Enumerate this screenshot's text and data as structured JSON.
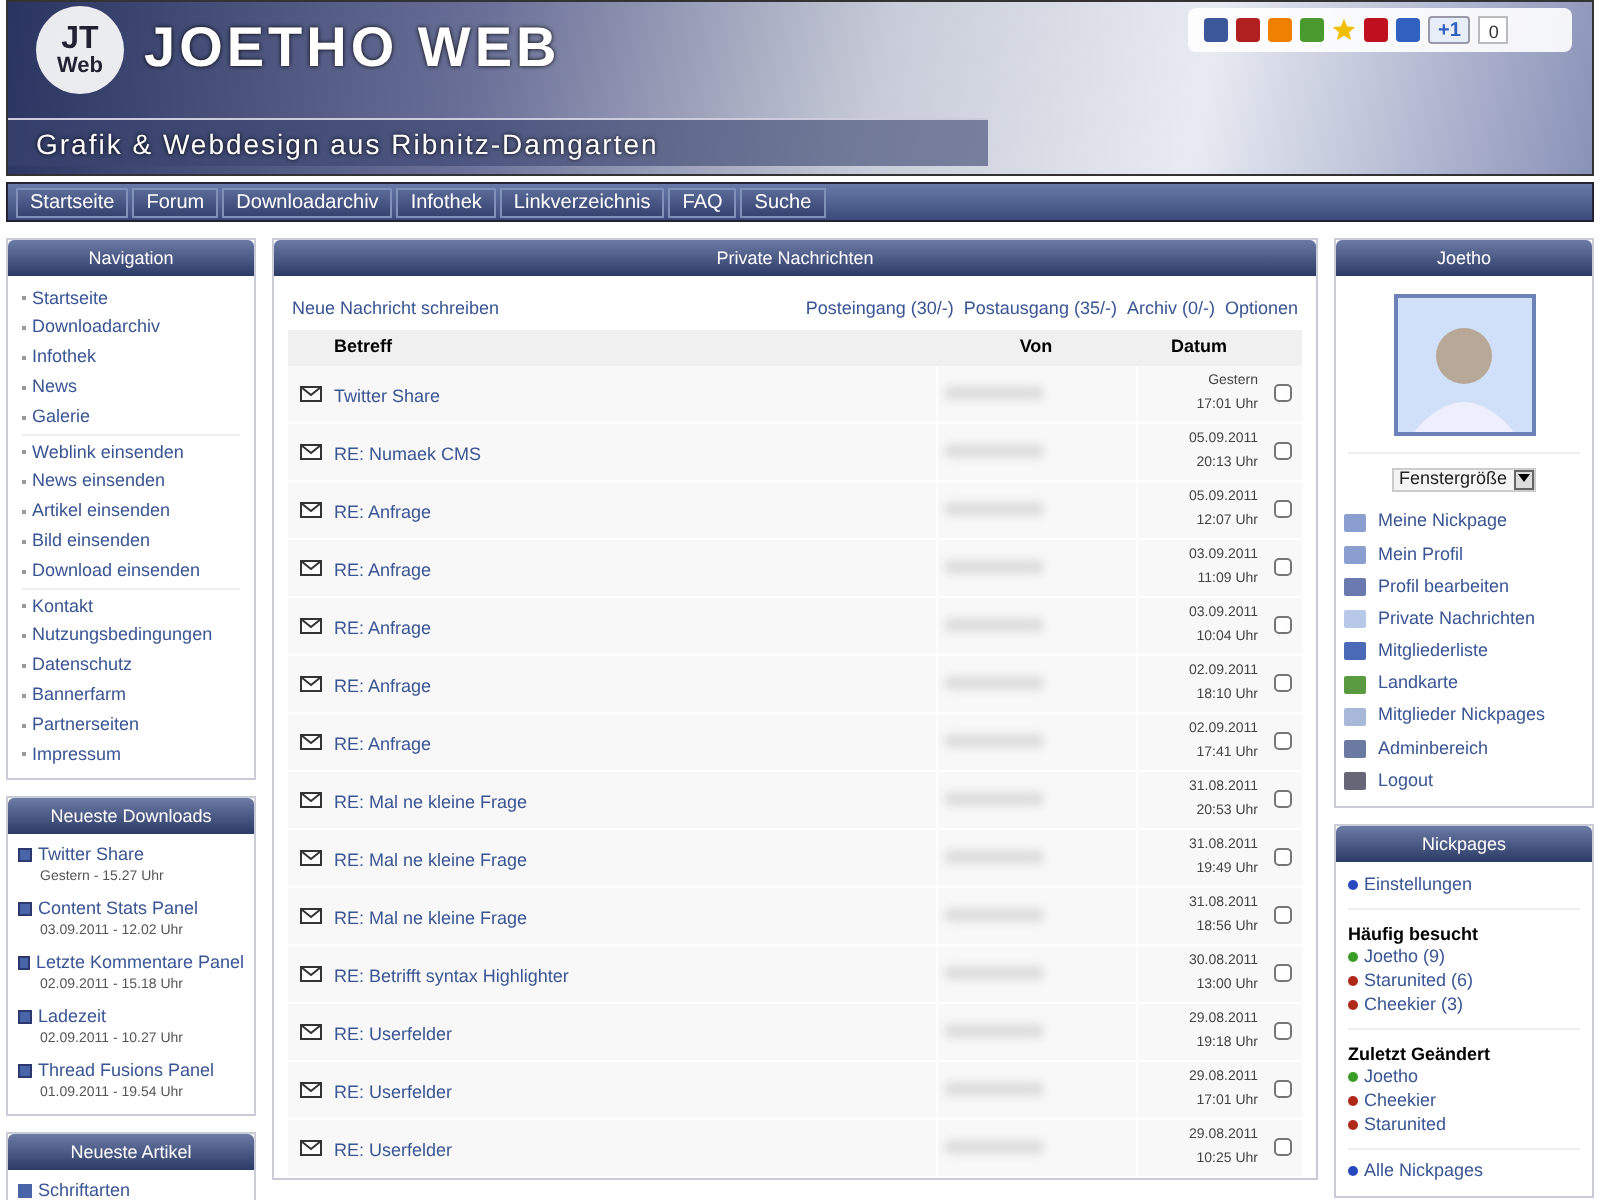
{
  "header": {
    "logo_top": "JT",
    "logo_bottom": "Web",
    "title": "JOETHO WEB",
    "tagline": "Grafik & Webdesign aus Ribnitz-Damgarten",
    "plus_one": "+1",
    "count": "0"
  },
  "menu": [
    "Startseite",
    "Forum",
    "Downloadarchiv",
    "Infothek",
    "Linkverzeichnis",
    "FAQ",
    "Suche"
  ],
  "navigation": {
    "title": "Navigation",
    "groups": [
      [
        "Startseite",
        "Downloadarchiv",
        "Infothek",
        "News",
        "Galerie"
      ],
      [
        "Weblink einsenden",
        "News einsenden",
        "Artikel einsenden",
        "Bild einsenden",
        "Download einsenden"
      ],
      [
        "Kontakt",
        "Nutzungsbedingungen",
        "Datenschutz",
        "Bannerfarm",
        "Partnerseiten",
        "Impressum"
      ]
    ]
  },
  "downloads": {
    "title": "Neueste Downloads",
    "items": [
      {
        "name": "Twitter Share",
        "date": "Gestern - 15.27 Uhr"
      },
      {
        "name": "Content Stats Panel",
        "date": "03.09.2011 - 12.02 Uhr"
      },
      {
        "name": "Letzte Kommentare Panel",
        "date": "02.09.2011 - 15.18 Uhr"
      },
      {
        "name": "Ladezeit",
        "date": "02.09.2011 - 10.27 Uhr"
      },
      {
        "name": "Thread Fusions Panel",
        "date": "01.09.2011 - 19.54 Uhr"
      }
    ]
  },
  "articles": {
    "title": "Neueste Artikel",
    "items": [
      "Schriftarten"
    ]
  },
  "messages": {
    "title": "Private Nachrichten",
    "new_link": "Neue Nachricht schreiben",
    "folders": [
      "Posteingang (30/-)",
      "Postausgang (35/-)",
      "Archiv (0/-)",
      "Optionen"
    ],
    "columns": [
      "Betreff",
      "Von",
      "Datum"
    ],
    "rows": [
      {
        "subject": "Twitter Share",
        "date": "Gestern",
        "time": "17:01 Uhr",
        "checked": false
      },
      {
        "subject": "RE: Numaek CMS",
        "date": "05.09.2011",
        "time": "20:13 Uhr",
        "checked": false
      },
      {
        "subject": "RE: Anfrage",
        "date": "05.09.2011",
        "time": "12:07 Uhr",
        "checked": false
      },
      {
        "subject": "RE: Anfrage",
        "date": "03.09.2011",
        "time": "11:09 Uhr",
        "checked": false
      },
      {
        "subject": "RE: Anfrage",
        "date": "03.09.2011",
        "time": "10:04 Uhr",
        "checked": false
      },
      {
        "subject": "RE: Anfrage",
        "date": "02.09.2011",
        "time": "18:10 Uhr",
        "checked": false
      },
      {
        "subject": "RE: Anfrage",
        "date": "02.09.2011",
        "time": "17:41 Uhr",
        "checked": false
      },
      {
        "subject": "RE: Mal ne kleine Frage",
        "date": "31.08.2011",
        "time": "20:53 Uhr",
        "checked": false
      },
      {
        "subject": "RE: Mal ne kleine Frage",
        "date": "31.08.2011",
        "time": "19:49 Uhr",
        "checked": false
      },
      {
        "subject": "RE: Mal ne kleine Frage",
        "date": "31.08.2011",
        "time": "18:56 Uhr",
        "checked": false
      },
      {
        "subject": "RE: Betrifft syntax Highlighter",
        "date": "30.08.2011",
        "time": "13:00 Uhr",
        "checked": false
      },
      {
        "subject": "RE: Userfelder",
        "date": "29.08.2011",
        "time": "19:18 Uhr",
        "checked": false
      },
      {
        "subject": "RE: Userfelder",
        "date": "29.08.2011",
        "time": "17:01 Uhr",
        "checked": false
      },
      {
        "subject": "RE: Userfelder",
        "date": "29.08.2011",
        "time": "10:25 Uhr",
        "checked": false
      }
    ]
  },
  "user": {
    "title": "Joetho",
    "select": "Fenstergröße",
    "links": [
      "Meine Nickpage",
      "Mein Profil",
      "Profil bearbeiten",
      "Private Nachrichten",
      "Mitgliederliste",
      "Landkarte",
      "Mitglieder Nickpages",
      "Adminbereich",
      "Logout"
    ]
  },
  "nickpages": {
    "title": "Nickpages",
    "settings": {
      "label": "Einstellungen",
      "color": "#2848c0"
    },
    "sections": [
      {
        "heading": "Häufig besucht",
        "items": [
          {
            "label": "Joetho (9)",
            "color": "#3c9c28"
          },
          {
            "label": "Starunited (6)",
            "color": "#b02818"
          },
          {
            "label": "Cheekier (3)",
            "color": "#b02818"
          }
        ]
      },
      {
        "heading": "Zuletzt Geändert",
        "items": [
          {
            "label": "Joetho",
            "color": "#3c9c28"
          },
          {
            "label": "Cheekier",
            "color": "#b02818"
          },
          {
            "label": "Starunited",
            "color": "#b02818"
          }
        ]
      }
    ],
    "all": {
      "label": "Alle Nickpages",
      "color": "#2848c0"
    }
  }
}
